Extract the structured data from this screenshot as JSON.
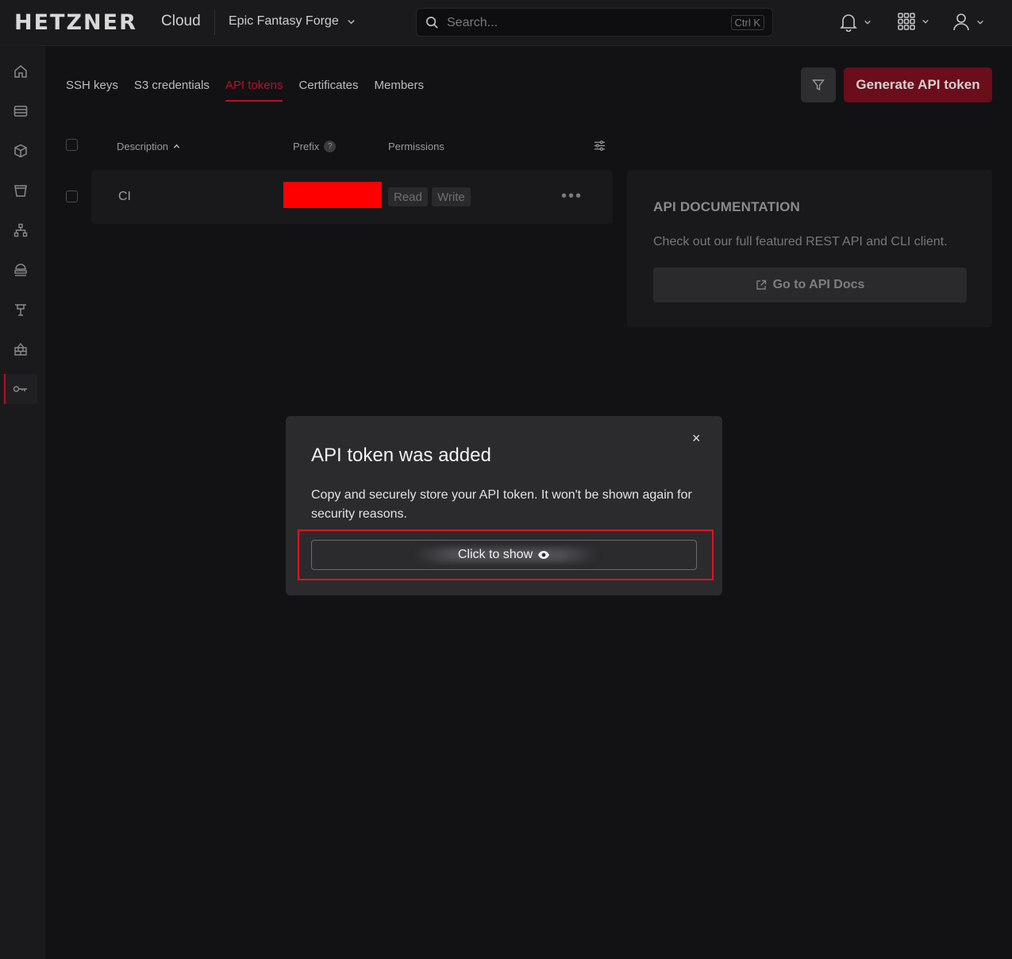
{
  "header": {
    "logo": "HETZNER",
    "product": "Cloud",
    "project": "Epic Fantasy Forge",
    "search_placeholder": "Search...",
    "search_shortcut": "Ctrl K"
  },
  "sidebar": {
    "items": [
      {
        "icon": "home-icon"
      },
      {
        "icon": "servers-icon"
      },
      {
        "icon": "volumes-icon"
      },
      {
        "icon": "storage-bucket-icon"
      },
      {
        "icon": "networks-icon"
      },
      {
        "icon": "load-balancers-icon"
      },
      {
        "icon": "primary-ips-icon"
      },
      {
        "icon": "firewalls-icon"
      },
      {
        "icon": "security-key-icon",
        "active": true
      }
    ]
  },
  "tabs": [
    "SSH keys",
    "S3 credentials",
    "API tokens",
    "Certificates",
    "Members"
  ],
  "active_tab": "API tokens",
  "actions": {
    "generate": "Generate API token"
  },
  "table": {
    "headers": {
      "description": "Description",
      "prefix": "Prefix",
      "prefix_help": "?",
      "permissions": "Permissions"
    },
    "rows": [
      {
        "description": "CI",
        "permissions": [
          "Read",
          "Write"
        ]
      }
    ]
  },
  "docs": {
    "title": "API DOCUMENTATION",
    "text": "Check out our full featured REST API and CLI client.",
    "button": "Go to API Docs"
  },
  "modal": {
    "title": "API token was added",
    "text": "Copy and securely store your API token. It won't be shown again for security reasons.",
    "show_button": "Click to show",
    "close": "×"
  },
  "colors": {
    "accent": "#b5122b",
    "highlight": "#e0141e",
    "redaction": "#ff0000"
  }
}
